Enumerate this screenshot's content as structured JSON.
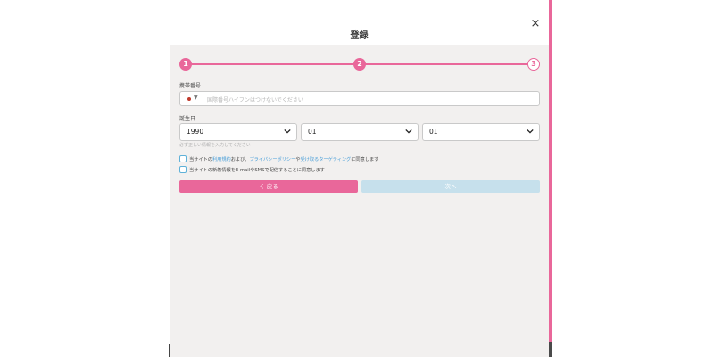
{
  "modal": {
    "title": "登録",
    "close_label": "×"
  },
  "stepper": {
    "steps": [
      {
        "label": "1",
        "state": "done"
      },
      {
        "label": "2",
        "state": "done"
      },
      {
        "label": "3",
        "state": "next"
      }
    ],
    "active_color": "#e9679a"
  },
  "phone": {
    "label": "携帯番号",
    "placeholder": "国際番号ハイフンはつけないでください",
    "country_flag_color": "#c0392b"
  },
  "birthdate": {
    "label": "誕生日",
    "year": "1990",
    "month": "01",
    "day": "01",
    "hint": "必ず正しい情報を入力してください"
  },
  "consent": {
    "terms_prefix": "当サイトの",
    "terms_link": "利用規約",
    "terms_mid": "および、",
    "privacy_link": "プライバシーポリシー",
    "terms_mid2": "や",
    "tracking_link": "受け取るターゲティング",
    "terms_suffix": "に同意します",
    "newsletter_text": "当サイトの新着情報をE-mailやSMSで配信することに同意します"
  },
  "buttons": {
    "back_label": "く 戻る",
    "next_label": "次へ",
    "back_color": "#e9679a",
    "next_color": "#c6e0ec"
  }
}
